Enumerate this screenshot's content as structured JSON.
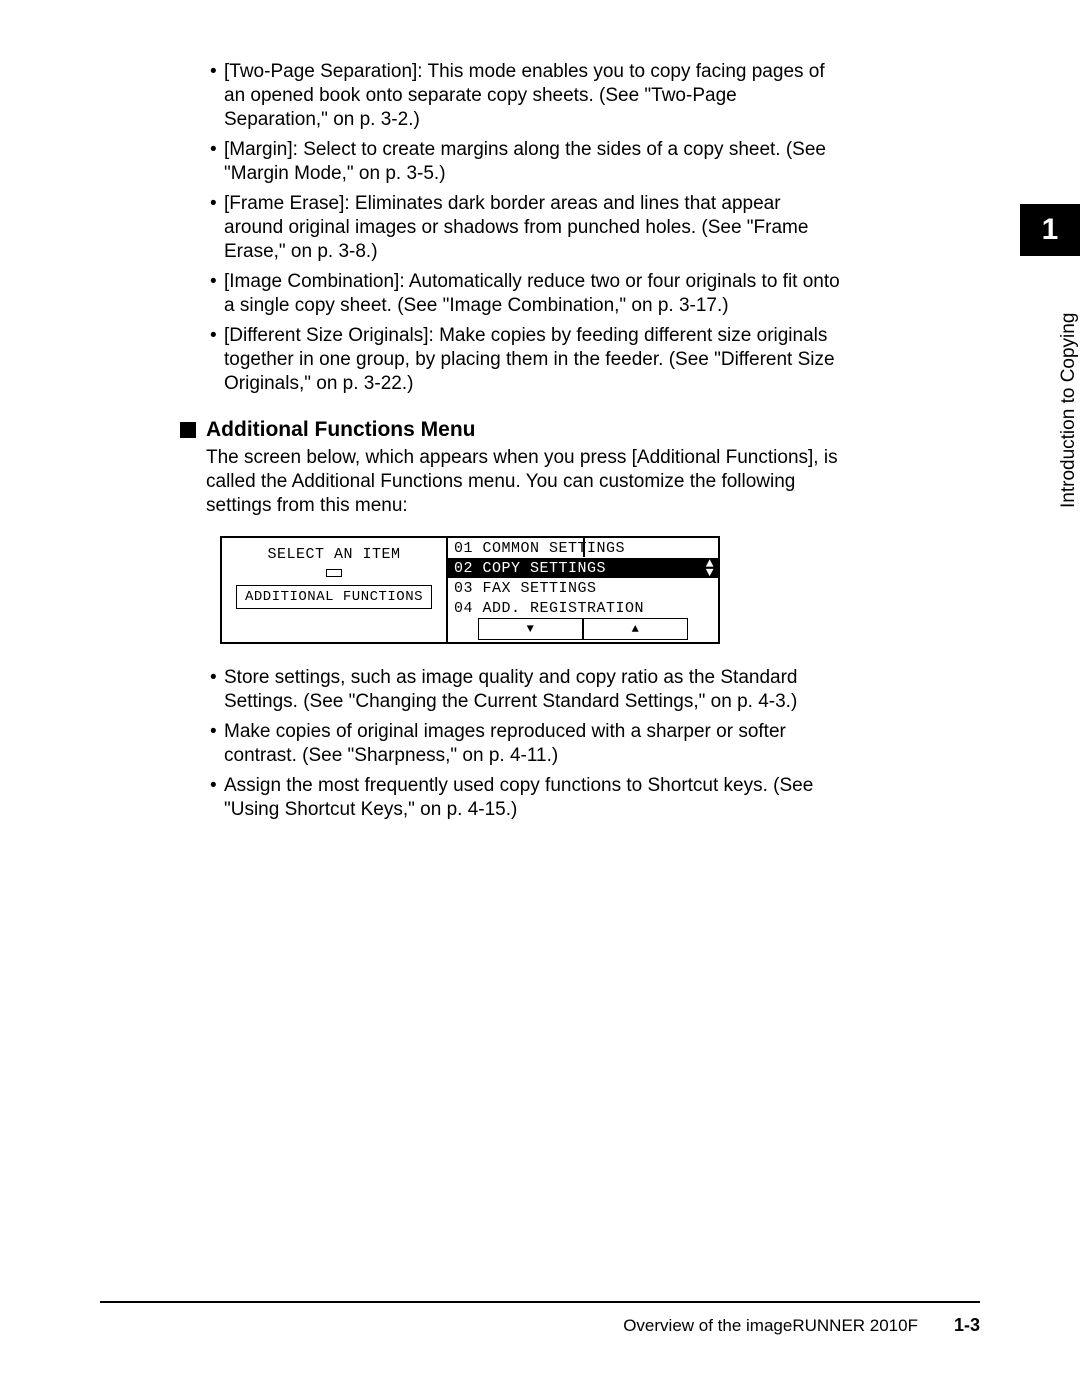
{
  "bullets_top": [
    "[Two-Page Separation]: This mode enables you to copy facing pages of an opened book onto separate copy sheets. (See \"Two-Page Separation,\" on p. 3-2.)",
    "[Margin]: Select to create margins along the sides of a copy sheet. (See \"Margin Mode,\" on p. 3-5.)",
    "[Frame Erase]: Eliminates dark border areas and lines that appear around original images or shadows from punched holes. (See \"Frame Erase,\" on p. 3-8.)",
    "[Image Combination]: Automatically reduce two or four originals to fit onto a single copy sheet. (See \"Image Combination,\" on p. 3-17.)",
    "[Different Size Originals]: Make copies by feeding different size originals together in one group, by placing them in the feeder. (See \"Different Size Originals,\" on p. 3-22.)"
  ],
  "section": {
    "title": "Additional Functions Menu",
    "intro": "The screen below, which appears when you press [Additional Functions], is called the Additional Functions menu. You can customize the following settings from this menu:"
  },
  "lcd": {
    "left_title": "SELECT AN ITEM",
    "left_button": "ADDITIONAL FUNCTIONS",
    "rows": [
      {
        "text": "01 COMMON SETTINGS",
        "selected": false
      },
      {
        "text": "02 COPY SETTINGS",
        "selected": true
      },
      {
        "text": "03 FAX SETTINGS",
        "selected": false
      },
      {
        "text": "04 ADD. REGISTRATION",
        "selected": false
      }
    ],
    "down": "▼",
    "up": "▲"
  },
  "bullets_bottom": [
    "Store settings, such as image quality and copy ratio as the Standard Settings. (See \"Changing the Current Standard Settings,\" on p. 4-3.)",
    "Make copies of original images reproduced with a sharper or softer contrast. (See \"Sharpness,\" on p. 4-11.)",
    "Assign the most frequently used copy functions to Shortcut keys. (See \"Using Shortcut Keys,\" on p. 4-15.)"
  ],
  "sidetab": {
    "number": "1",
    "text": "Introduction to Copying"
  },
  "footer": {
    "title": "Overview of the imageRUNNER 2010F",
    "page": "1-3"
  }
}
